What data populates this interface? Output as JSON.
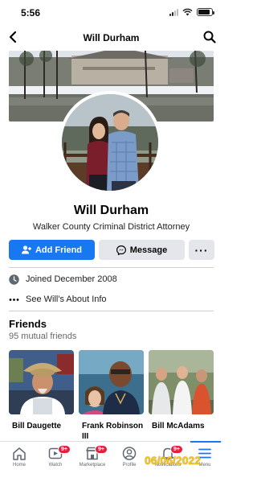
{
  "status_bar": {
    "time": "5:56"
  },
  "header": {
    "title": "Will Durham"
  },
  "profile": {
    "name": "Will Durham",
    "bio": "Walker County Criminal District Attorney"
  },
  "actions": {
    "add_friend": "Add Friend",
    "message": "Message",
    "more": "···"
  },
  "details": {
    "joined": "Joined December 2008",
    "about": "See Will's About Info"
  },
  "friends": {
    "title": "Friends",
    "mutual": "95 mutual friends",
    "items": [
      {
        "name": "Bill Daugette"
      },
      {
        "name": "Frank Robinson III"
      },
      {
        "name": "Bill McAdams"
      }
    ]
  },
  "tab_bar": {
    "tabs": [
      {
        "label": "Home",
        "icon": "home-icon"
      },
      {
        "label": "Watch",
        "icon": "watch-icon",
        "badge": "9+"
      },
      {
        "label": "Marketplace",
        "icon": "marketplace-icon",
        "badge": "9+"
      },
      {
        "label": "Profile",
        "icon": "profile-icon"
      },
      {
        "label": "Notifications",
        "icon": "bell-icon",
        "badge": "9+"
      },
      {
        "label": "Menu",
        "icon": "menu-icon"
      }
    ]
  },
  "watermark": "06/06/2022",
  "colors": {
    "accent": "#1877f2",
    "badge": "#e41e3f",
    "watermark": "#f5c518"
  }
}
